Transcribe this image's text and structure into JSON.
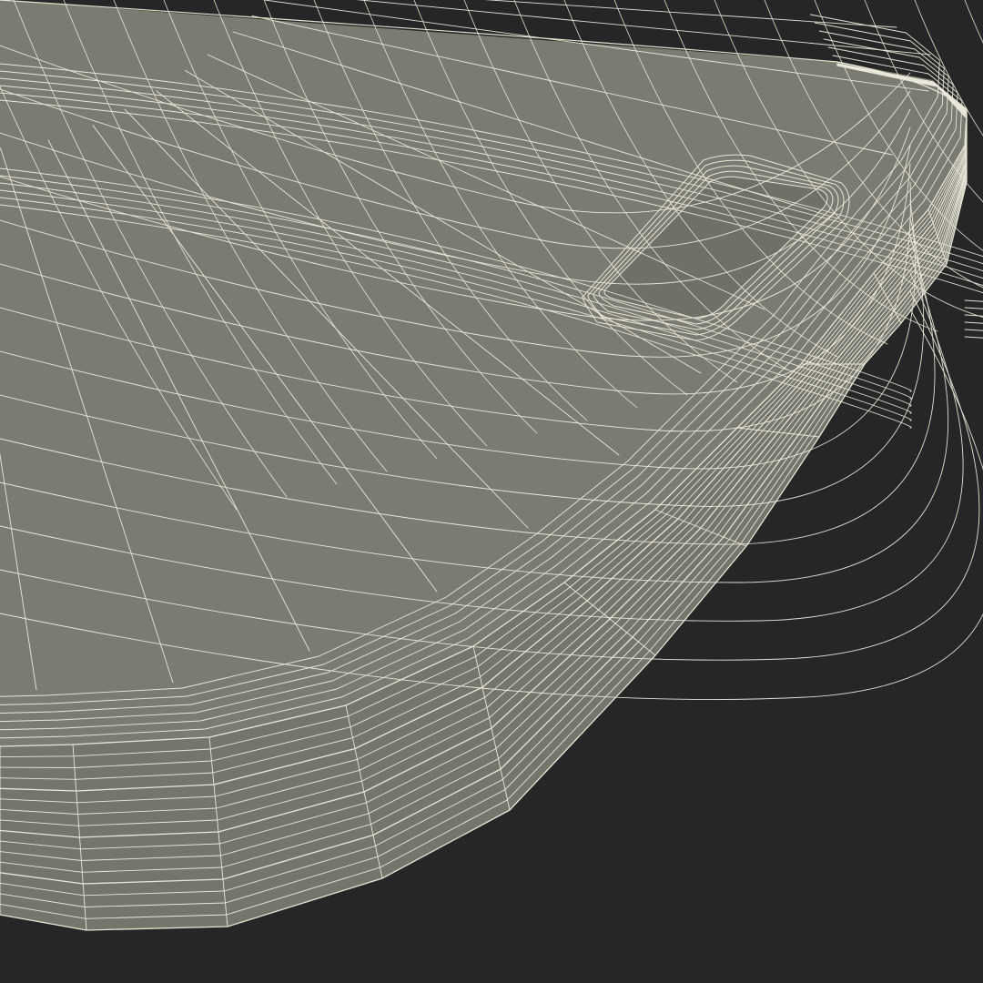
{
  "scene": {
    "subject": "phone-case-wireframe-render",
    "colors": {
      "background": "#262626",
      "surface": "#7b7b71",
      "surface_shadow": "#6c6c63",
      "side_wall": "#75756c",
      "wire": "#f3f1e2"
    }
  }
}
